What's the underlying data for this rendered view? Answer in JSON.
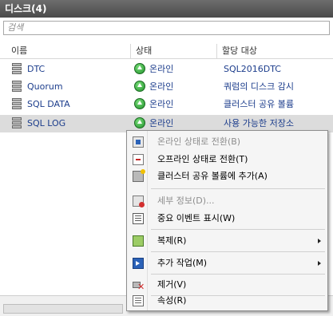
{
  "window": {
    "title": "디스크(4)"
  },
  "search": {
    "placeholder": "검색"
  },
  "columns": {
    "name": "이름",
    "status": "상태",
    "owner": "할당 대상"
  },
  "rows": [
    {
      "name": "DTC",
      "status": "온라인",
      "owner": "SQL2016DTC",
      "selected": false
    },
    {
      "name": "Quorum",
      "status": "온라인",
      "owner": "쿼럼의 디스크 감시",
      "selected": false
    },
    {
      "name": "SQL DATA",
      "status": "온라인",
      "owner": "클러스터 공유 볼륨",
      "selected": false
    },
    {
      "name": "SQL LOG",
      "status": "온라인",
      "owner": "사용 가능한 저장소",
      "selected": true
    }
  ],
  "context_menu": {
    "items": [
      {
        "label": "온라인 상태로 전환(B)",
        "icon": "online-state-icon",
        "enabled": false
      },
      {
        "label": "오프라인 상태로 전환(T)",
        "icon": "offline-state-icon",
        "enabled": true
      },
      {
        "label": "클러스터 공유 볼륨에 추가(A)",
        "icon": "add-csv-icon",
        "enabled": true
      },
      {
        "label": "세부 정보(D)...",
        "icon": "details-icon",
        "enabled": false
      },
      {
        "label": "중요 이벤트 표시(W)",
        "icon": "events-icon",
        "enabled": true
      },
      {
        "label": "복제(R)",
        "icon": "replication-icon",
        "enabled": true,
        "submenu": true
      },
      {
        "label": "추가 작업(M)",
        "icon": "more-actions-icon",
        "enabled": true,
        "submenu": true
      },
      {
        "label": "제거(V)",
        "icon": "remove-icon",
        "enabled": true
      },
      {
        "label": "속성(R)",
        "icon": "properties-icon",
        "enabled": true
      }
    ]
  }
}
